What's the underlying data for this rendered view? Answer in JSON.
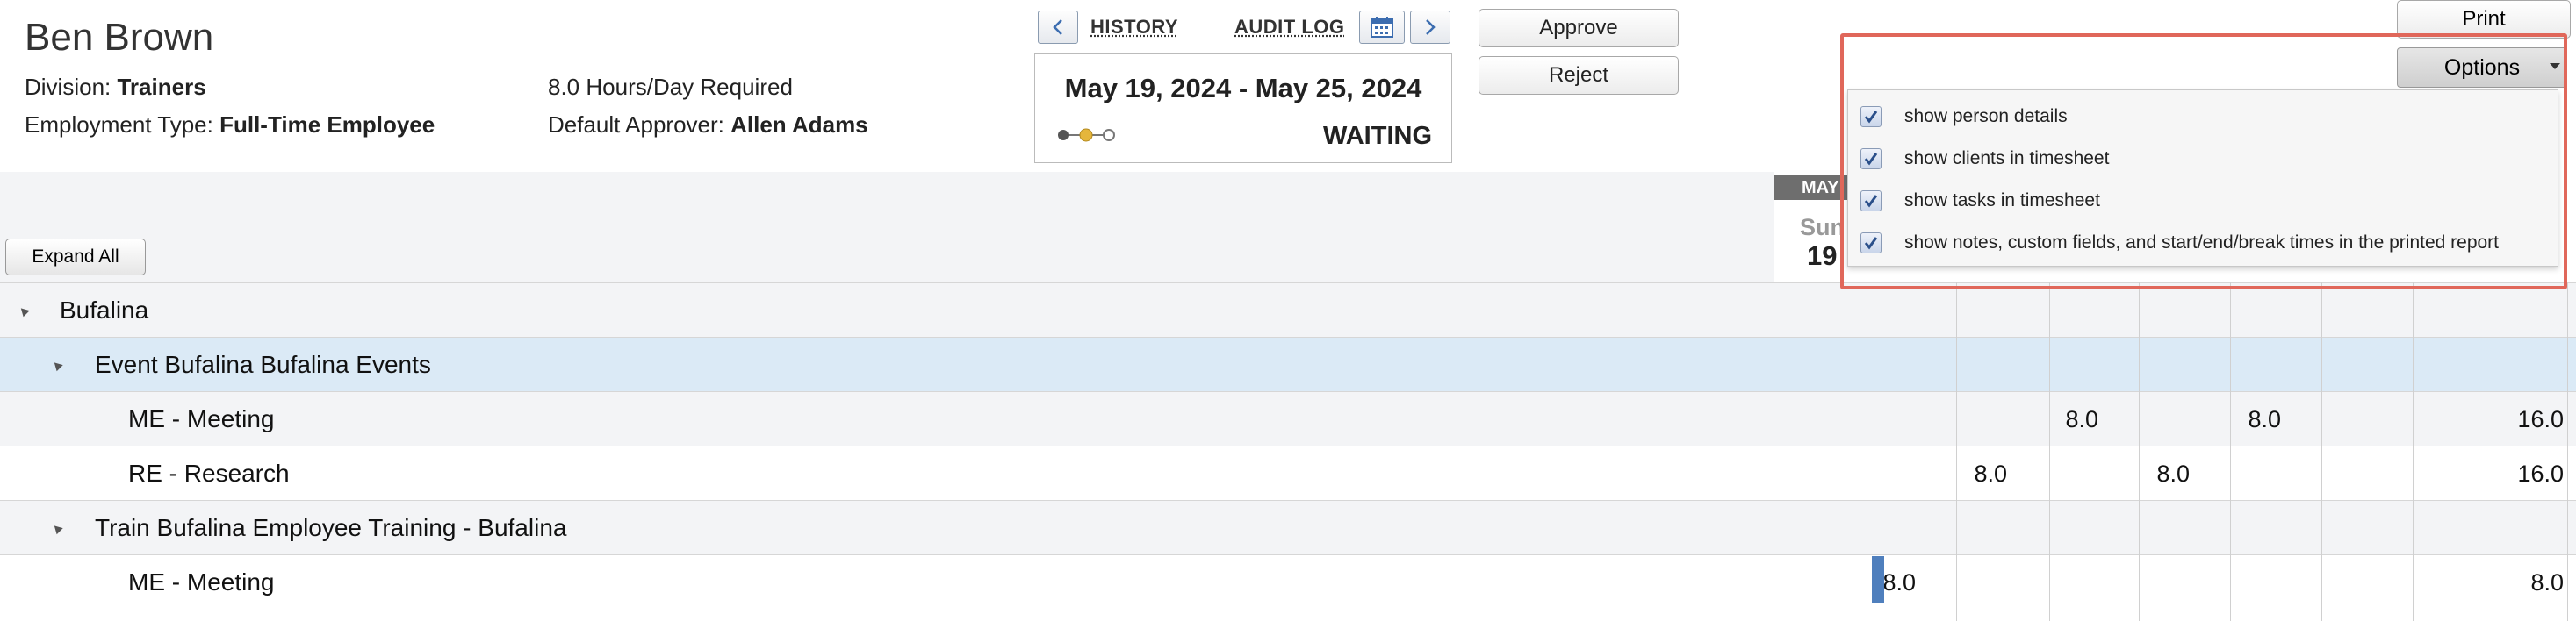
{
  "person": {
    "name": "Ben Brown",
    "division_label": "Division: ",
    "division": "Trainers",
    "employment_label": "Employment Type: ",
    "employment": "Full-Time Employee",
    "hours_required": "8.0 Hours/Day Required",
    "approver_label": "Default Approver: ",
    "approver": "Allen Adams"
  },
  "nav": {
    "history": "HISTORY",
    "audit_log": "AUDIT LOG"
  },
  "period": {
    "range": "May 19, 2024 - May 25, 2024",
    "status": "WAITING",
    "progress_step": 2,
    "progress_steps": 3
  },
  "actions": {
    "approve": "Approve",
    "reject": "Reject",
    "print": "Print",
    "options": "Options",
    "expand_all": "Expand All"
  },
  "options_menu": [
    {
      "label": "show person details",
      "checked": true
    },
    {
      "label": "show clients in timesheet",
      "checked": true
    },
    {
      "label": "show tasks in timesheet",
      "checked": true
    },
    {
      "label": "show notes, custom fields, and start/end/break times in the printed report",
      "checked": true
    }
  ],
  "calendar": {
    "month": "MAY",
    "day_name": "Sun",
    "day_number": "19"
  },
  "rows": [
    {
      "label": "Bufalina",
      "level": 0,
      "expandable": true,
      "values": [
        "",
        "",
        "",
        "",
        "",
        "",
        "",
        ""
      ]
    },
    {
      "label": "Event Bufalina Bufalina Events",
      "level": 1,
      "expandable": true,
      "values": [
        "",
        "",
        "",
        "",
        "",
        "",
        "",
        ""
      ]
    },
    {
      "label": "ME - Meeting",
      "level": 2,
      "expandable": false,
      "values": [
        "",
        "",
        "8.0",
        "",
        "8.0",
        "",
        "",
        "16.0"
      ]
    },
    {
      "label": "RE - Research",
      "level": 2,
      "expandable": false,
      "values": [
        "",
        "8.0",
        "",
        "8.0",
        "",
        "",
        "",
        "16.0"
      ]
    },
    {
      "label": "Train Bufalina Employee Training - Bufalina",
      "level": 1,
      "expandable": true,
      "values": [
        "",
        "",
        "",
        "",
        "",
        "",
        "",
        ""
      ]
    },
    {
      "label": "ME - Meeting",
      "level": 2,
      "expandable": false,
      "values": [
        "8.0",
        "",
        "",
        "",
        "",
        "",
        "",
        "8.0"
      ]
    }
  ],
  "colors": {
    "highlight": "#e0675a",
    "selected_row": "#dbeaf6",
    "group_row": "#f3f4f6",
    "entry_bar": "#4f7fbd"
  }
}
